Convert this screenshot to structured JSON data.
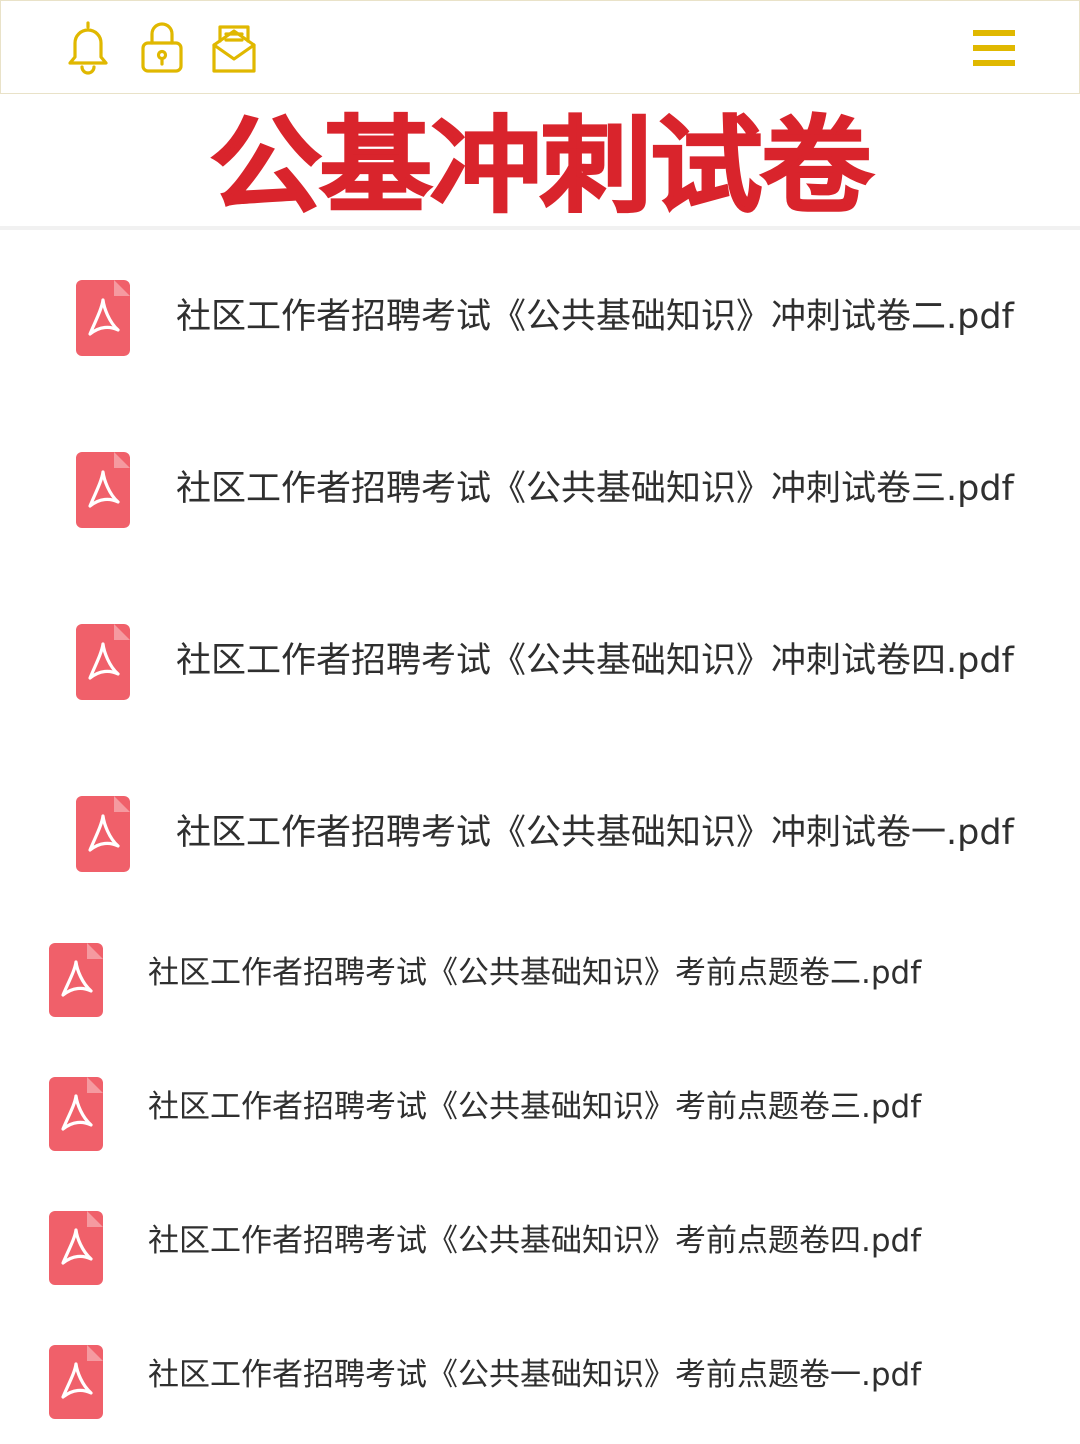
{
  "header": {
    "icons": [
      "bell-icon",
      "lock-icon",
      "mail-icon",
      "menu-icon"
    ],
    "accent_color": "#e0b800"
  },
  "headline": {
    "text": "公基冲刺试卷",
    "color": "#d9242c"
  },
  "sprint_files": [
    {
      "name": "社区工作者招聘考试《公共基础知识》冲刺试卷二.pdf",
      "icon": "pdf-icon"
    },
    {
      "name": "社区工作者招聘考试《公共基础知识》冲刺试卷三.pdf",
      "icon": "pdf-icon"
    },
    {
      "name": "社区工作者招聘考试《公共基础知识》冲刺试卷四.pdf",
      "icon": "pdf-icon"
    },
    {
      "name": "社区工作者招聘考试《公共基础知识》冲刺试卷一.pdf",
      "icon": "pdf-icon"
    }
  ],
  "preexam_files": [
    {
      "name": "社区工作者招聘考试《公共基础知识》考前点题卷二.pdf",
      "icon": "pdf-icon"
    },
    {
      "name": "社区工作者招聘考试《公共基础知识》考前点题卷三.pdf",
      "icon": "pdf-icon"
    },
    {
      "name": "社区工作者招聘考试《公共基础知识》考前点题卷四.pdf",
      "icon": "pdf-icon"
    },
    {
      "name": "社区工作者招聘考试《公共基础知识》考前点题卷一.pdf",
      "icon": "pdf-icon"
    }
  ],
  "pdf_icon_color": "#f0606a"
}
